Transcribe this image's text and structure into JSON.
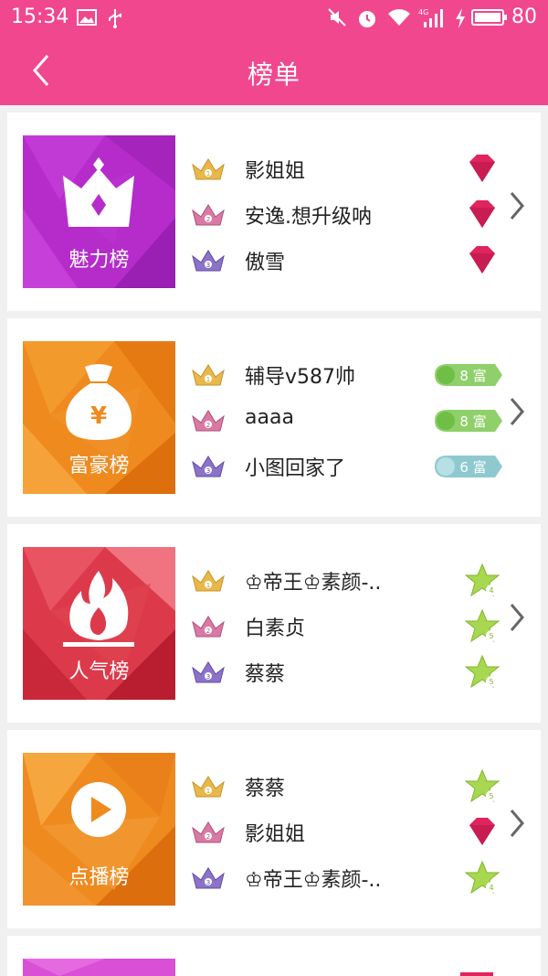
{
  "status": {
    "time": "15:34",
    "battery": "80",
    "icons": [
      "image-icon",
      "usb-icon",
      "mute-icon",
      "alarm-icon",
      "wifi-icon",
      "signal-4g-icon",
      "charging-icon",
      "battery-icon"
    ]
  },
  "header": {
    "title": "榜单",
    "back_icon": "back-arrow-icon"
  },
  "colors": {
    "brand": "#f1478f"
  },
  "boards": [
    {
      "label": "魅力榜",
      "icon": "crown-icon",
      "entries": [
        {
          "rank": "1",
          "name": "影姐姐",
          "badge": "gem-icon"
        },
        {
          "rank": "2",
          "name": "安逸.想升级呐",
          "badge": "gem-icon"
        },
        {
          "rank": "3",
          "name": "傲雪",
          "badge": "gem-icon"
        }
      ]
    },
    {
      "label": "富豪榜",
      "icon": "money-bag-icon",
      "bag_text": "¥",
      "entries": [
        {
          "rank": "1",
          "name": "辅导v587帅",
          "badge": "rich-level-badge",
          "badge_text": "8 富"
        },
        {
          "rank": "2",
          "name": "aaaa",
          "badge": "rich-level-badge",
          "badge_text": "8 富"
        },
        {
          "rank": "3",
          "name": "小图回家了",
          "badge": "rich-level-badge",
          "badge_text": "6 富"
        }
      ]
    },
    {
      "label": "人气榜",
      "icon": "flame-icon",
      "entries": [
        {
          "rank": "1",
          "name": "♔帝王♔素颜-..",
          "badge": "star-level-icon",
          "badge_text": "4"
        },
        {
          "rank": "2",
          "name": "白素贞",
          "badge": "star-level-icon",
          "badge_text": "5"
        },
        {
          "rank": "3",
          "name": "蔡蔡",
          "badge": "star-level-icon",
          "badge_text": "5"
        }
      ]
    },
    {
      "label": "点播榜",
      "icon": "play-icon",
      "entries": [
        {
          "rank": "1",
          "name": "蔡蔡",
          "badge": "star-level-icon",
          "badge_text": "5"
        },
        {
          "rank": "2",
          "name": "影姐姐",
          "badge": "gem-icon"
        },
        {
          "rank": "3",
          "name": "♔帝王♔素颜-..",
          "badge": "star-level-icon",
          "badge_text": "4"
        }
      ]
    }
  ]
}
